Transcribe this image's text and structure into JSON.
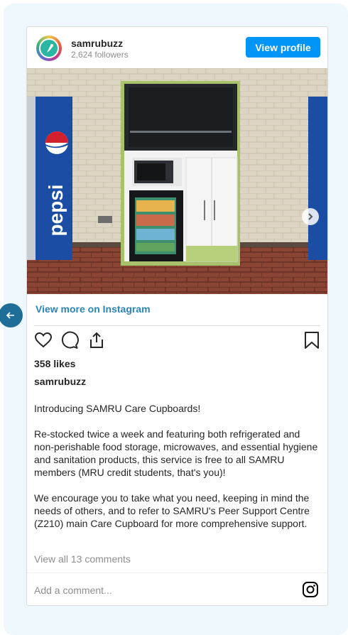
{
  "post": {
    "username": "samrubuzz",
    "followers": "2,624 followers",
    "view_profile_label": "View profile",
    "view_more_label": "View more on Instagram",
    "likes": "358 likes",
    "caption_username": "samrubuzz",
    "caption_paragraphs": [
      "Introducing SAMRU Care Cupboards!",
      "Re-stocked twice a week and featuring both refrigerated and non-perishable food storage, microwaves, and essential hygiene and sanitation products, this service is free to all SAMRU members (MRU credit students, that's you)!",
      "We encourage you to take what you need, keeping in mind the needs of others, and to refer to SAMRU's Peer Support Centre (Z210) main Care Cupboard for more comprehensive support."
    ],
    "view_comments_label": "View all 13 comments",
    "comment_placeholder": "Add a comment...",
    "photo_text": "pepsi"
  },
  "icons": {
    "back": "arrow-left-icon",
    "next": "chevron-right-icon",
    "like": "heart-icon",
    "comment": "comment-bubble-icon",
    "share": "share-icon",
    "save": "bookmark-icon",
    "instagram": "instagram-icon"
  },
  "colors": {
    "accent": "#0095f6",
    "link": "#2b84b6",
    "back_button": "#1f6e98",
    "panel_bg": "#eef7fc"
  }
}
